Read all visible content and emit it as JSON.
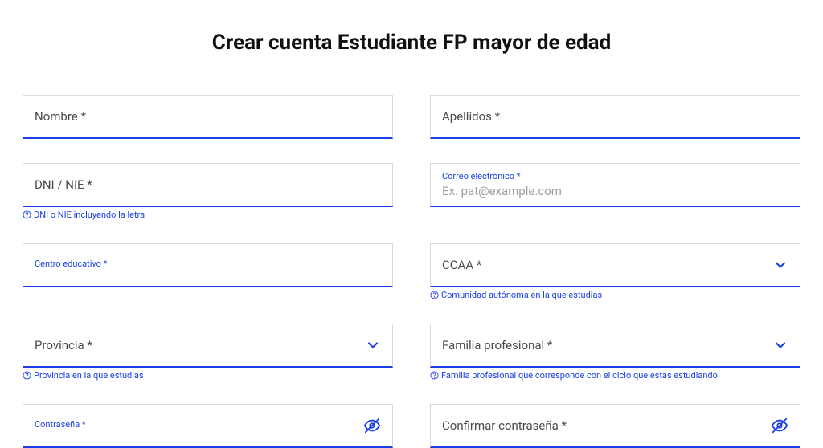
{
  "title": "Crear cuenta Estudiante FP mayor de edad",
  "fields": {
    "nombre": {
      "label": "Nombre *"
    },
    "apellidos": {
      "label": "Apellidos *"
    },
    "dni": {
      "label": "DNI / NIE *",
      "helper": "DNI o NIE incluyendo la letra"
    },
    "correo": {
      "tinyLabel": "Correo electrónico *",
      "placeholder": "Ex. pat@example.com"
    },
    "centro": {
      "tinyLabel": "Centro educativo *"
    },
    "ccaa": {
      "label": "CCAA *",
      "helper": "Comunidad autónoma en la que estudias"
    },
    "provincia": {
      "label": "Provincia *",
      "helper": "Provincia en la que estudias"
    },
    "familia": {
      "label": "Familia profesional *",
      "helper": "Familia profesional que corresponde con el ciclo que estás estudiando"
    },
    "contrasena": {
      "tinyLabel": "Contraseña *"
    },
    "confirmar": {
      "label": "Confirmar contraseña *"
    }
  }
}
